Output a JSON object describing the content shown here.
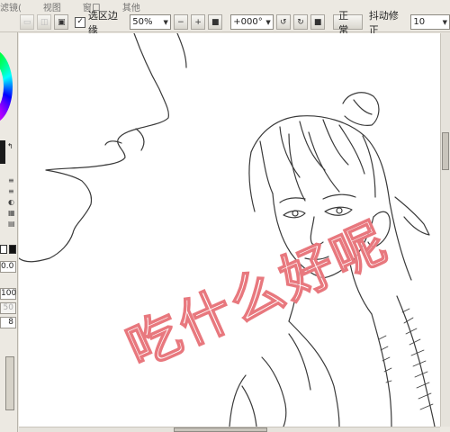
{
  "menu": {
    "items": [
      "滤镜(",
      "视图",
      "窗口",
      "其他"
    ]
  },
  "toolbar": {
    "selection_edge_label": "选区边缘",
    "selection_edge_checked": "✓",
    "zoom_value": "50%",
    "rotation_value": "+000°",
    "normal_label": "正常",
    "stabilizer_label": "抖动修正",
    "stabilizer_value": "10"
  },
  "left_panel": {
    "opacity_value": "0.0",
    "size_value": "100",
    "value_50": "50",
    "value_8": "8"
  },
  "watermark": {
    "text": "吃什么好呢"
  },
  "colors": {
    "background": "#ece9e2",
    "canvas": "#ffffff",
    "watermark_stroke": "#e8787e"
  }
}
